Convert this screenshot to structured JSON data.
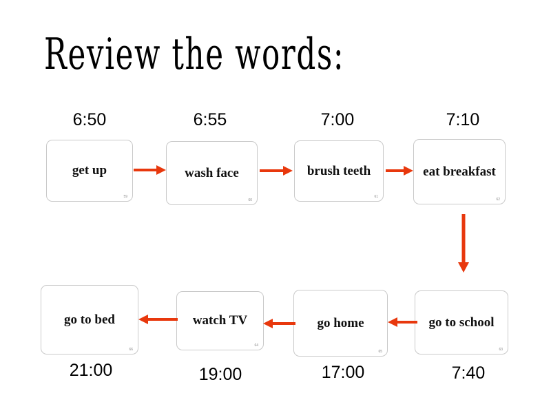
{
  "slide": {
    "title": "Review the words:",
    "background_color": "#ffffff",
    "arrow_color": "#e8380d",
    "card_border_color": "#c9c9c9",
    "text_color": "#111111"
  },
  "rows": [
    {
      "id": "row-1",
      "direction": "left-to-right",
      "cards": [
        {
          "label": "get up",
          "time": "6:50",
          "number": "59"
        },
        {
          "label": "wash face",
          "time": "6:55",
          "number": "60"
        },
        {
          "label": "brush teeth",
          "time": "7:00",
          "number": "61"
        },
        {
          "label": "eat breakfast",
          "time": "7:10",
          "number": "62"
        }
      ]
    },
    {
      "id": "row-2",
      "direction": "right-to-left",
      "cards": [
        {
          "label": "go to bed",
          "time": "21:00",
          "number": "66"
        },
        {
          "label": "watch TV",
          "time": "19:00",
          "number": "64"
        },
        {
          "label": "go home",
          "time": "17:00",
          "number": "65"
        },
        {
          "label": "go to school",
          "time": "7:40",
          "number": "63"
        }
      ]
    }
  ],
  "connectors": {
    "vertical_label": "down-arrow-connector",
    "horizontal_label": "right-arrow-connector",
    "horizontal_back_label": "left-arrow-connector"
  }
}
